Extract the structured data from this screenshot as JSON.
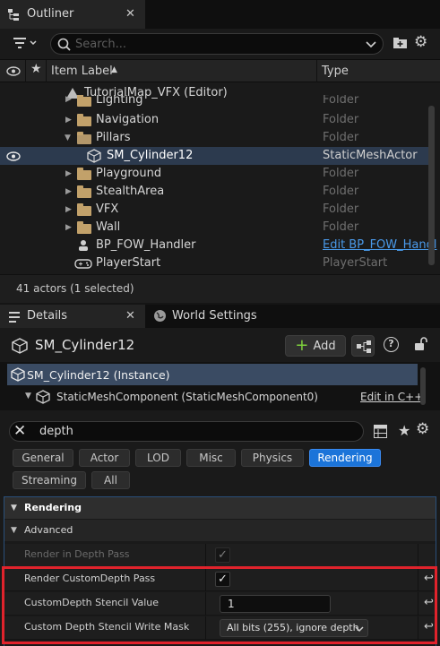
{
  "outliner": {
    "title": "Outliner",
    "close": "✕",
    "search_placeholder": "Search...",
    "col_label": "Item Label",
    "col_type": "Type",
    "rows": [
      {
        "label": "TutorialMap_VFX (Editor)",
        "type": ""
      },
      {
        "label": "Lighting",
        "type": "Folder"
      },
      {
        "label": "Navigation",
        "type": "Folder"
      },
      {
        "label": "Pillars",
        "type": "Folder"
      },
      {
        "label": "SM_Cylinder12",
        "type": "StaticMeshActor"
      },
      {
        "label": "Playground",
        "type": "Folder"
      },
      {
        "label": "StealthArea",
        "type": "Folder"
      },
      {
        "label": "VFX",
        "type": "Folder"
      },
      {
        "label": "Wall",
        "type": "Folder"
      },
      {
        "label": "BP_FOW_Handler",
        "type": "Edit BP_FOW_Handl"
      },
      {
        "label": "PlayerStart",
        "type": "PlayerStart"
      }
    ],
    "status": "41 actors (1 selected)"
  },
  "details": {
    "title": "Details",
    "close": "✕",
    "world_settings": "World Settings",
    "actor_name": "SM_Cylinder12",
    "add_label": "Add",
    "instance_label": "SM_Cylinder12 (Instance)",
    "component_label": "StaticMeshComponent (StaticMeshComponent0)",
    "edit_cpp": "Edit in C++",
    "search_value": "depth",
    "filters": [
      "General",
      "Actor",
      "LOD",
      "Misc",
      "Physics",
      "Rendering",
      "Streaming",
      "All"
    ],
    "active_filter": "Rendering",
    "category": "Rendering",
    "subcategory": "Advanced",
    "properties": [
      {
        "name": "Render in Depth Pass",
        "value": "checked",
        "disabled": true
      },
      {
        "name": "Render CustomDepth Pass",
        "value": "checked",
        "disabled": false
      },
      {
        "name": "CustomDepth Stencil Value",
        "value": "1",
        "disabled": false
      },
      {
        "name": "Custom Depth Stencil Write Mask",
        "value": "All bits (255), ignore depth",
        "disabled": false
      }
    ]
  },
  "colors": {
    "selection": "#2c3a4e",
    "accent": "#1b74d9",
    "highlight_box": "#e0232c",
    "folder": "#c2a16a",
    "link": "#4a9aea"
  }
}
